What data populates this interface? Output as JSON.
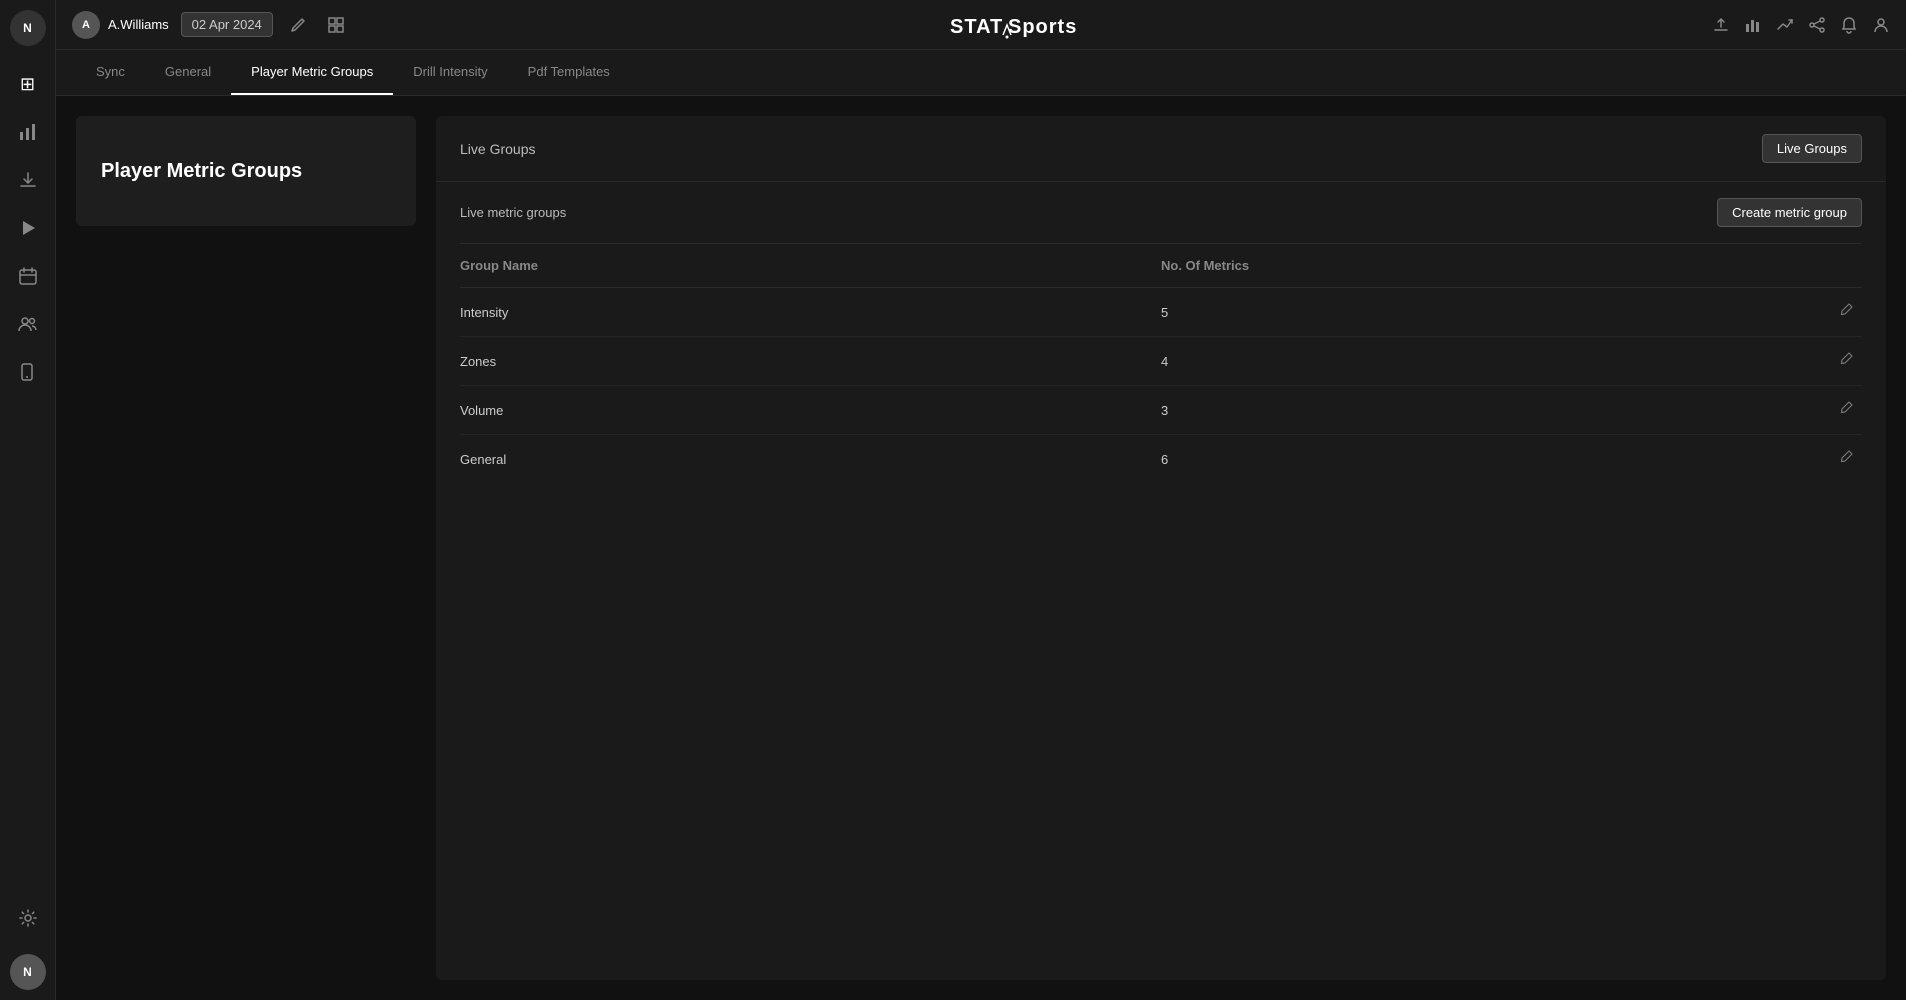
{
  "app": {
    "logo_text": "STATSports"
  },
  "topbar": {
    "user_initial": "A",
    "user_name": "A.Williams",
    "date": "02 Apr 2024",
    "edit_icon": "✏",
    "grid_icon": "⊞"
  },
  "topbar_right": {
    "upload_icon": "⬆",
    "bar_chart_icon": "📊",
    "trend_icon": "📈",
    "share_icon": "⬆",
    "bell_icon": "🔔",
    "profile_icon": "👤"
  },
  "sidebar": {
    "logo_initial": "N",
    "items": [
      {
        "icon": "⊞",
        "name": "dashboard"
      },
      {
        "icon": "📉",
        "name": "analytics"
      },
      {
        "icon": "⬇",
        "name": "download"
      },
      {
        "icon": "▶",
        "name": "play"
      },
      {
        "icon": "📅",
        "name": "calendar"
      },
      {
        "icon": "👥",
        "name": "team"
      },
      {
        "icon": "▦",
        "name": "device"
      },
      {
        "icon": "⚙",
        "name": "settings"
      }
    ],
    "bottom_initial": "N"
  },
  "tabs": [
    {
      "label": "Sync",
      "active": false
    },
    {
      "label": "General",
      "active": false
    },
    {
      "label": "Player Metric Groups",
      "active": true
    },
    {
      "label": "Drill Intensity",
      "active": false
    },
    {
      "label": "Pdf Templates",
      "active": false
    }
  ],
  "page_title": "Player Metric Groups",
  "live_groups_section": {
    "label": "Live Groups",
    "button_label": "Live Groups"
  },
  "live_metric_groups_section": {
    "label": "Live metric groups",
    "create_button_label": "Create metric group"
  },
  "table": {
    "headers": [
      {
        "label": "Group Name",
        "key": "group_name"
      },
      {
        "label": "No. Of Metrics",
        "key": "no_of_metrics"
      },
      {
        "label": "",
        "key": "action"
      }
    ],
    "rows": [
      {
        "group_name": "Intensity",
        "no_of_metrics": "5"
      },
      {
        "group_name": "Zones",
        "no_of_metrics": "4"
      },
      {
        "group_name": "Volume",
        "no_of_metrics": "3"
      },
      {
        "group_name": "General",
        "no_of_metrics": "6"
      }
    ]
  }
}
